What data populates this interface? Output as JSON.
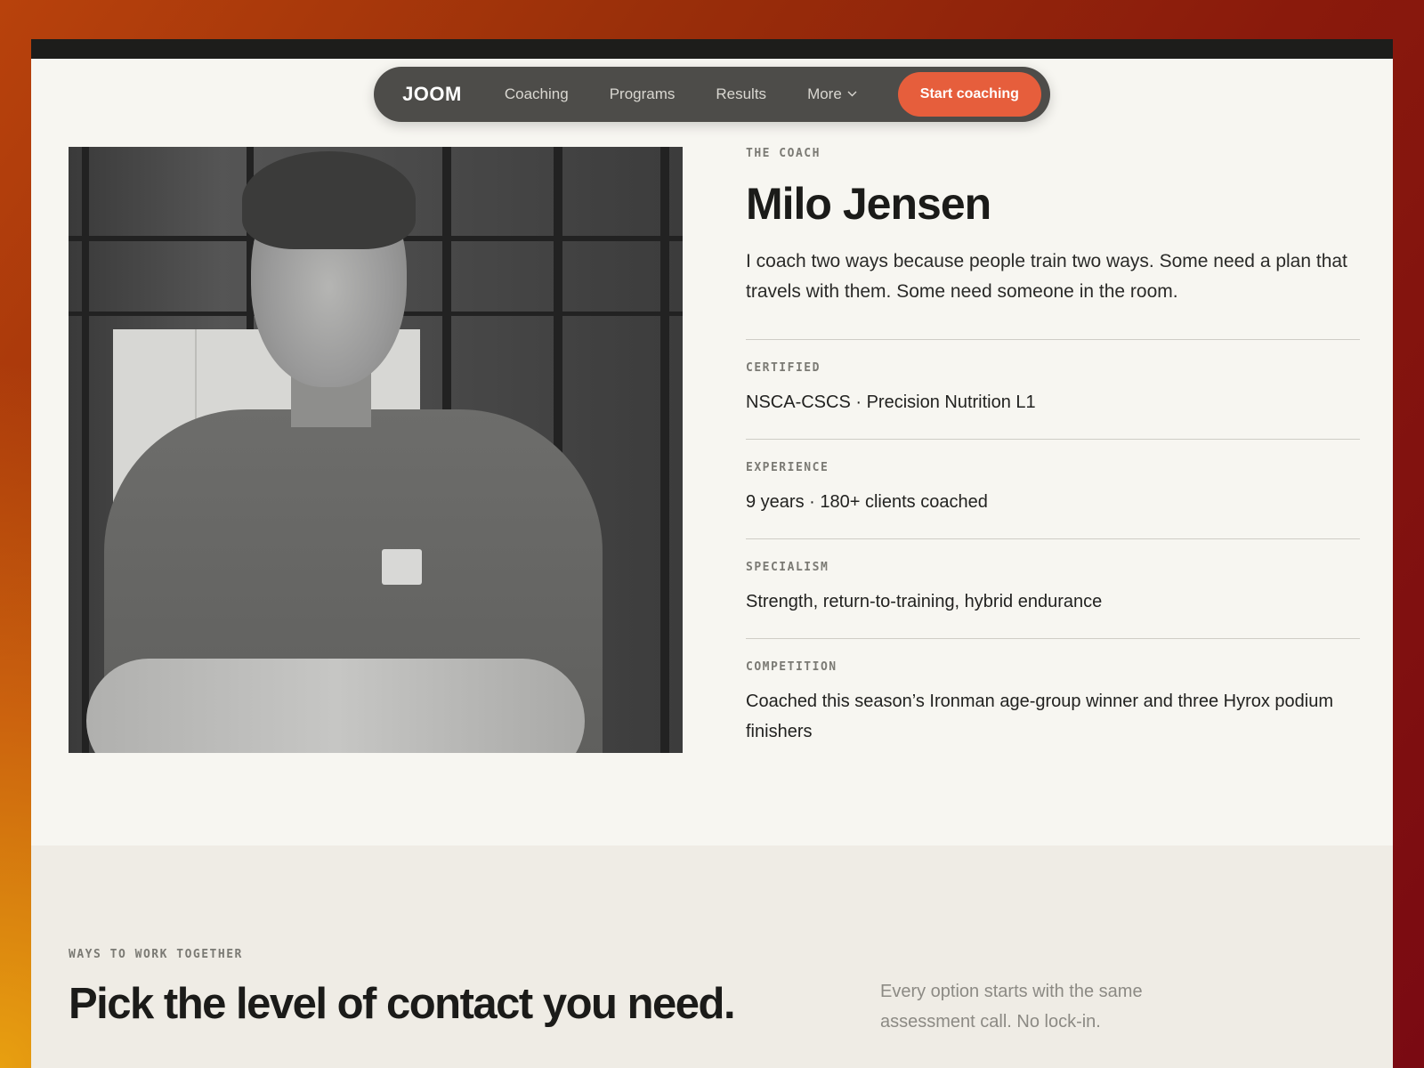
{
  "nav": {
    "logo": "JOOM",
    "links": [
      "Coaching",
      "Programs",
      "Results",
      "More"
    ],
    "cta": "Start coaching"
  },
  "coach": {
    "eyebrow": "THE COACH",
    "name": "Milo Jensen",
    "intro": "I coach two ways because people train two ways. Some need a plan that travels with them. Some need someone in the room.",
    "facts": [
      {
        "label": "CERTIFIED",
        "value": "NSCA-CSCS · Precision Nutrition L1"
      },
      {
        "label": "EXPERIENCE",
        "value": "9 years · 180+ clients coached"
      },
      {
        "label": "SPECIALISM",
        "value": "Strength, return-to-training, hybrid endurance"
      },
      {
        "label": "COMPETITION",
        "value": "Coached this season’s Ironman age-group winner and three Hyrox podium finishers"
      }
    ]
  },
  "options": {
    "eyebrow": "WAYS TO WORK TOGETHER",
    "title": "Pick the level of contact you need.",
    "note": "Every option starts with the same assessment call. No lock-in."
  },
  "icons": {
    "more": "chevron-down-icon"
  }
}
